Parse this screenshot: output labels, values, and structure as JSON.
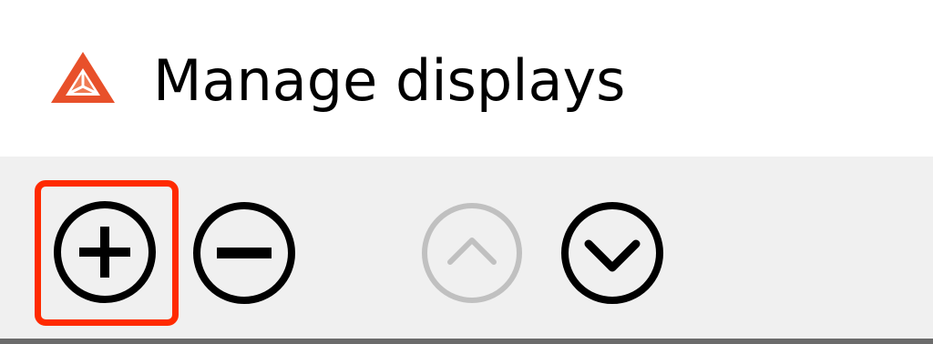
{
  "window": {
    "title": "Manage displays",
    "logo_icon": "app-logo-icon"
  },
  "toolbar": {
    "buttons": [
      {
        "id": "add",
        "icon": "plus-circle-icon",
        "enabled": true,
        "highlighted": true
      },
      {
        "id": "remove",
        "icon": "minus-circle-icon",
        "enabled": true,
        "highlighted": false
      },
      {
        "id": "move_up",
        "icon": "chevron-up-circle-icon",
        "enabled": false,
        "highlighted": false
      },
      {
        "id": "move_down",
        "icon": "chevron-down-circle-icon",
        "enabled": true,
        "highlighted": false
      }
    ]
  },
  "colors": {
    "logo": "#e8502a",
    "highlight": "#ff2a00",
    "toolbar_bg": "#f0f0f0",
    "icon_enabled": "#000000",
    "icon_disabled": "#c0c0c0"
  }
}
